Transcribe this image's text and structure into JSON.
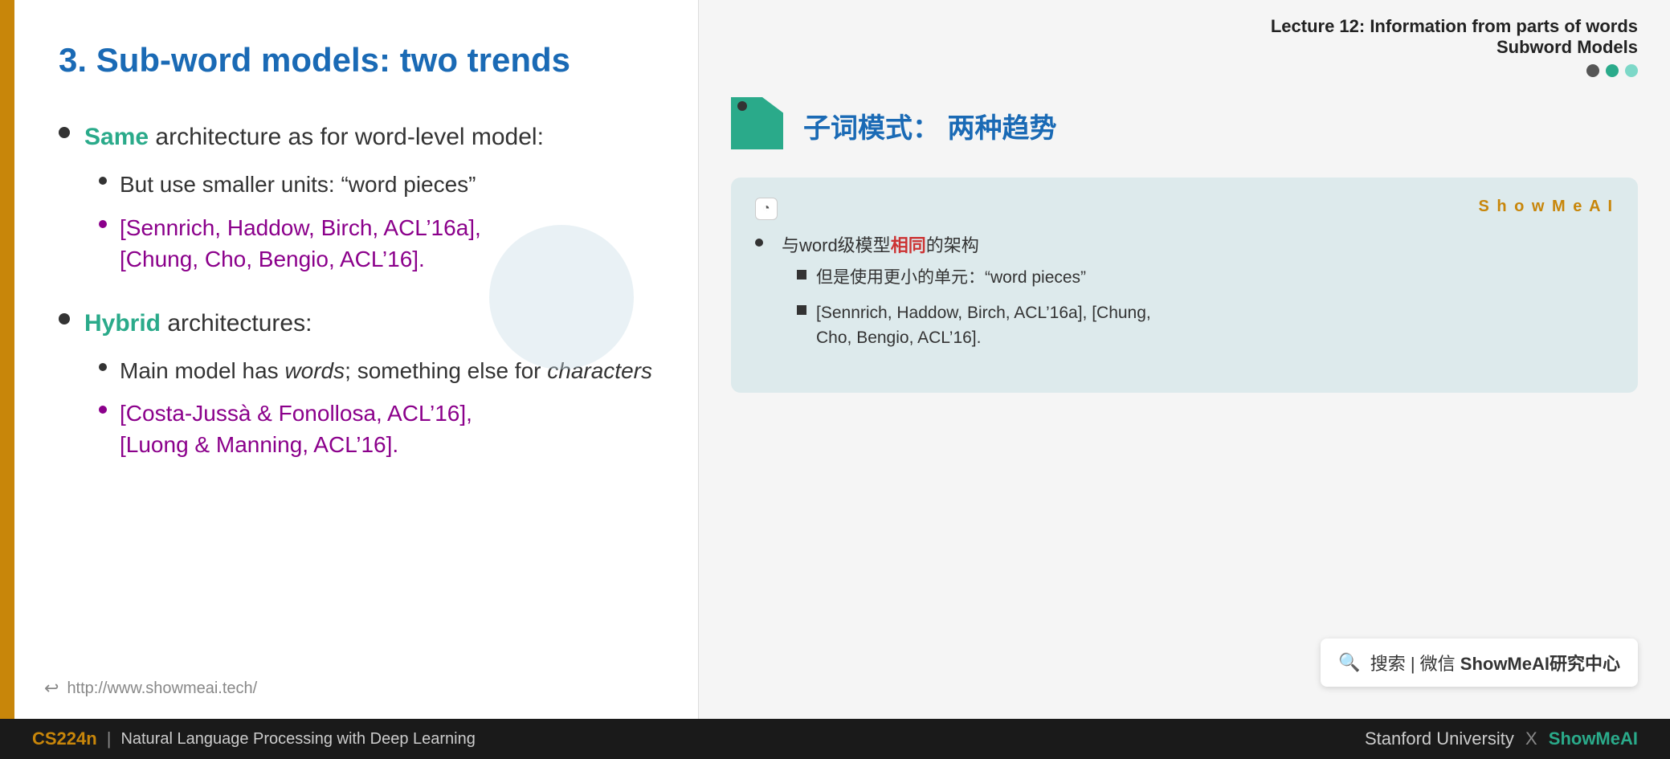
{
  "slide": {
    "title": "3. Sub-word models: two trends",
    "left_border_color": "#C8860A",
    "bullet1": {
      "prefix": "",
      "highlight": "Same",
      "suffix": " architecture as for word-level model:",
      "sub1": "But use smaller units: “word pieces”",
      "sub2": "[Sennrich, Haddow, Birch, ACL’16a],\n[Chung, Cho, Bengio, ACL’16]."
    },
    "bullet2": {
      "highlight": "Hybrid",
      "suffix": " architectures:",
      "sub1_prefix": "Main model has ",
      "sub1_italic1": "words",
      "sub1_mid": "; something else for ",
      "sub1_italic2": "characters",
      "sub2": "[Costa-Jussà & Fonollosa, ACL’16],\n[Luong & Manning, ACL’16]."
    },
    "footer_url": "http://www.showmeai.tech/"
  },
  "annotation": {
    "lecture_line1": "Lecture 12: Information from parts of words",
    "lecture_line2": "Subword Models",
    "section_title": "子词模式： 两种趋势",
    "card": {
      "brand": "S h o w M e A I",
      "bullet_main": "与word级模型相同的架构",
      "highlight_word": "相同",
      "sub1": "但是使用更小的单元：“word pieces”",
      "sub2": "[Sennrich, Haddow, Birch, ACL’16a], [Chung,\nCho, Bengio, ACL’16]."
    },
    "search_label": "搜索 | 微信 ShowMeAI研究中心"
  },
  "bottom_bar": {
    "course_code": "CS224n",
    "divider": "|",
    "course_name": "Natural Language Processing with Deep Learning",
    "university": "Stanford University",
    "x_symbol": "X",
    "brand": "ShowMeAI"
  }
}
